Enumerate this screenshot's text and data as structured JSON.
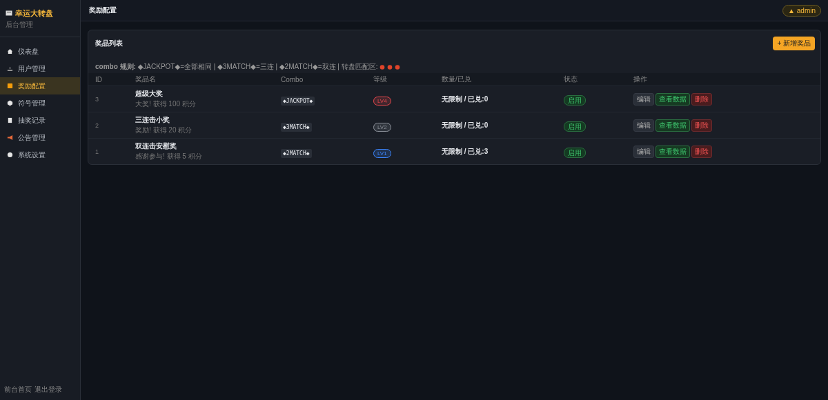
{
  "brand": {
    "title": "幸运大转盘",
    "subtitle": "后台管理"
  },
  "nav": [
    {
      "label": "仪表盘",
      "selected": false
    },
    {
      "label": "用户管理",
      "selected": false
    },
    {
      "label": "奖励配置",
      "selected": true
    },
    {
      "label": "符号管理",
      "selected": false
    },
    {
      "label": "抽奖记录",
      "selected": false
    },
    {
      "label": "公告管理",
      "selected": false
    },
    {
      "label": "系统设置",
      "selected": false
    }
  ],
  "footer_links": [
    "前台首页",
    "退出登录"
  ],
  "header": {
    "title": "奖励配置",
    "user": "▲ admin"
  },
  "card": {
    "title": "奖品列表",
    "add_button": "+ 新增奖品",
    "combo_rule": "**combo 规则:** ◆JACKPOT◆=全部相同 | ◆3MATCH◆=三连 | ◆2MATCH◆=双连 | 转盘匹配区:",
    "columns": [
      "ID",
      "奖品名",
      "Combo",
      "等级",
      "数量/已兑",
      "状态",
      "操作"
    ],
    "rows": [
      {
        "id": "3",
        "name": "超级大奖",
        "desc": "大奖! 获得 100 积分",
        "combo": "◆JACKPOT◆",
        "level": "LV4",
        "color": "#e5484d",
        "quantity": "无限制 / 已兑:0",
        "status": "启用",
        "enabled": true,
        "actions": [
          "编辑",
          "查看数据",
          "删除"
        ]
      },
      {
        "id": "2",
        "name": "三连击小奖",
        "desc": "奖励! 获得 20 积分",
        "combo": "◆3MATCH◆",
        "level": "LV2",
        "color": "#8b9099",
        "quantity": "无限制 / 已兑:0",
        "status": "启用",
        "enabled": true,
        "actions": [
          "编辑",
          "查看数据",
          "删除"
        ]
      },
      {
        "id": "1",
        "name": "双连击安慰奖",
        "desc": "感谢参与! 获得 5 积分",
        "combo": "◆2MATCH◆",
        "level": "LV1",
        "color": "#3b82f6",
        "quantity": "无限制 / 已兑:3",
        "status": "启用",
        "enabled": true,
        "actions": [
          "编辑",
          "查看数据",
          "删除"
        ]
      }
    ]
  }
}
